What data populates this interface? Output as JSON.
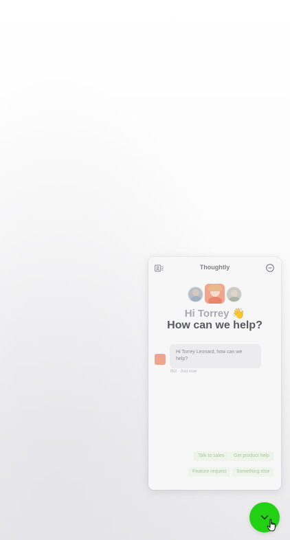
{
  "widget": {
    "title": "Thoughtly",
    "greeting": "Hi Torrey 👋",
    "headline": "How can we help?",
    "message": {
      "text": "Hi Torrey Leonard, how can we help?",
      "meta": "Bot · Just now"
    },
    "quick_replies": [
      "Talk to sales",
      "Get product help",
      "Feature request",
      "Something else"
    ],
    "icons": {
      "contacts": "contacts-icon",
      "minimize": "minimize-icon",
      "launcher": "chevron-down-icon"
    }
  },
  "colors": {
    "launcher": "#22d114",
    "chip_bg": "#eef4ea",
    "chip_text": "#a8c79b",
    "headline": "#58595e",
    "greeting": "#a9aab0"
  }
}
